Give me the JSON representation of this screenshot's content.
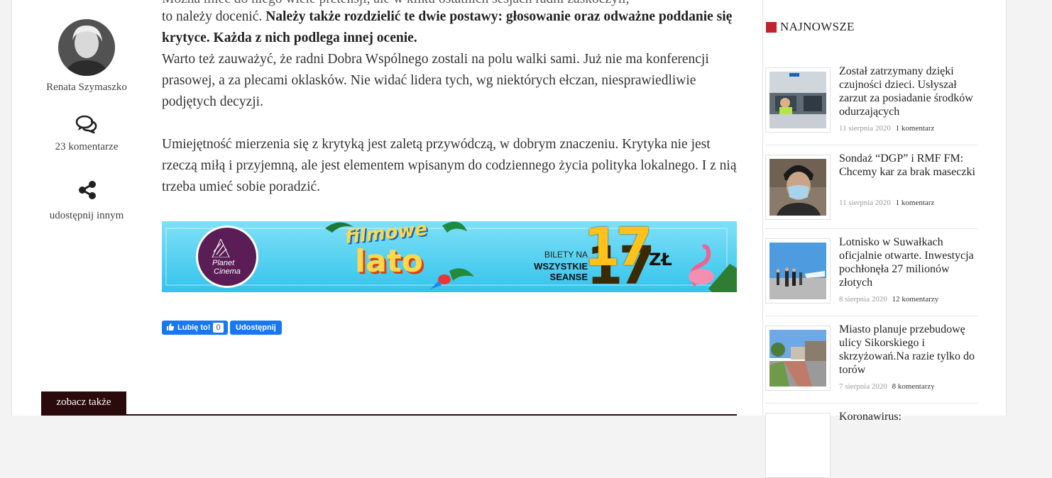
{
  "author": {
    "name": "Renata Szymaszko",
    "comments_count": "23 komentarze",
    "share_label": "udostępnij innym"
  },
  "article": {
    "cut_line": "Można mieć do niego wiele pretensji, ale w kilku ostatnich sesjach radni zaskoczyli,",
    "line_a": "to należy docenić.",
    "bold_a": "Należy także rozdzielić te dwie postawy: głosowanie oraz odważne poddanie się krytyce.  Każda z nich podlega innej ocenie.",
    "para_b": "Warto też zauważyć, że radni Dobra Wspólnego zostali na polu walki sami. Już nie ma konferencji prasowej, a za plecami oklasków. Nie widać lidera tych, wg niektórych ełczan, niesprawiedliwie podjętych decyzji.",
    "para_c": "Umiejętność mierzenia się z krytyką jest zaletą przywódczą, w dobrym znaczeniu. Krytyka nie jest rzeczą miłą i przyjemną, ale jest elementem wpisanym do codziennego życia polityka lokalnego. I z nią trzeba umieć sobie poradzić."
  },
  "banner": {
    "brand_top": "Planet",
    "brand_bottom": "Cinema",
    "title_top": "filmowe",
    "title_bottom": "lato",
    "tickets_line1": "BILETY NA",
    "tickets_line2": "WSZYSTKIE SEANSE",
    "price": "17",
    "currency": "ZŁ"
  },
  "social": {
    "like_label": "Lubię to!",
    "like_count": "0",
    "share_label": "Udostępnij"
  },
  "see_also": "zobacz także",
  "sidebar": {
    "title": "NAJNOWSZE",
    "items": [
      {
        "title": "Został zatrzymany dzięki czujności dzieci. Usłyszał zarzut za posiadanie środków odurzających",
        "date": "11 sierpnia 2020",
        "comments": "1 komentarz"
      },
      {
        "title": "Sondaż “DGP” i RMF FM: Chcemy kar za brak maseczki",
        "date": "11 sierpnia 2020",
        "comments": "1 komentarz"
      },
      {
        "title": "Lotnisko w Suwałkach oficjalnie otwarte. Inwestycja pochłonęła 27 milionów złotych",
        "date": "8 sierpnia 2020",
        "comments": "12 komentarzy"
      },
      {
        "title": "Miasto planuje przebudowę ulicy Sikorskiego i skrzyżowań.Na razie tylko do torów",
        "date": "7 sierpnia 2020",
        "comments": "8 komentarzy"
      }
    ],
    "cut_title": "Koronawirus:"
  },
  "colors": {
    "accent": "#c0232b",
    "facebook": "#1877f2",
    "see_also_bg": "#2a0a0a",
    "banner_bg": "#5fd4f2"
  }
}
